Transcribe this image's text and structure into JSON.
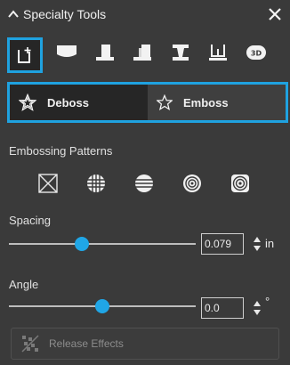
{
  "titlebar": {
    "title": "Specialty Tools",
    "collapse_icon": "chevron-up-icon",
    "close_icon": "close-icon"
  },
  "tools": [
    {
      "name": "cutout-tool",
      "active": true
    },
    {
      "name": "pillow-tool",
      "active": false
    },
    {
      "name": "chisel-tool",
      "active": false
    },
    {
      "name": "stairs-tool",
      "active": false
    },
    {
      "name": "bevel-tool",
      "active": false
    },
    {
      "name": "hole-tool",
      "active": false
    },
    {
      "name": "3d-view-tool",
      "active": false
    }
  ],
  "mode": {
    "options": [
      {
        "label": "Deboss",
        "selected": true,
        "icon": "star-outline-icon"
      },
      {
        "label": "Emboss",
        "selected": false,
        "icon": "star-outline-icon"
      }
    ]
  },
  "patterns": {
    "label": "Embossing Patterns",
    "items": [
      "none-pattern",
      "grid-pattern",
      "horizontal-lines-pattern",
      "concentric-circles-pattern",
      "concentric-squares-pattern"
    ]
  },
  "spacing": {
    "label": "Spacing",
    "value": "0.079",
    "unit": "in",
    "slider_level": 0.39
  },
  "angle": {
    "label": "Angle",
    "value": "0.0",
    "unit": "°",
    "slider_level": 0.5
  },
  "release": {
    "label": "Release Effects",
    "enabled": false
  },
  "colors": {
    "accent": "#1fa2e0",
    "background": "#3a3a3a",
    "thumb": "#20a6e6"
  }
}
